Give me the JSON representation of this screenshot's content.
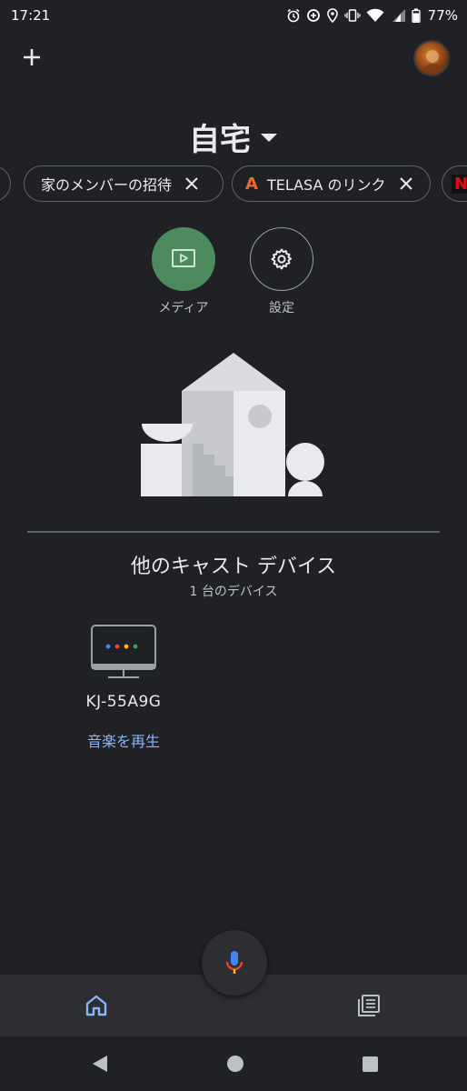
{
  "status_bar": {
    "time": "17:21",
    "battery": "77%",
    "icons": [
      "alarm-icon",
      "data-saver-icon",
      "location-icon",
      "vibrate-icon",
      "wifi-icon",
      "signal-icon",
      "battery-icon"
    ]
  },
  "header": {
    "home_name": "自宅"
  },
  "chips": [
    {
      "label": "家のメンバーの招待"
    },
    {
      "label": "TELASA のリンク",
      "logo": "A"
    },
    {
      "logo": "N"
    }
  ],
  "actions": [
    {
      "label": "メディア",
      "icon": "media-icon"
    },
    {
      "label": "設定",
      "icon": "gear-icon"
    }
  ],
  "section": {
    "title": "他のキャスト デバイス",
    "subtitle": "1 台のデバイス"
  },
  "devices": [
    {
      "name": "KJ-55A9G",
      "action": "音楽を再生",
      "icon": "tv-icon"
    }
  ],
  "colors": {
    "background": "#202124",
    "accent_blue": "#8ab4f8",
    "media_green": "#4d8b5f"
  }
}
